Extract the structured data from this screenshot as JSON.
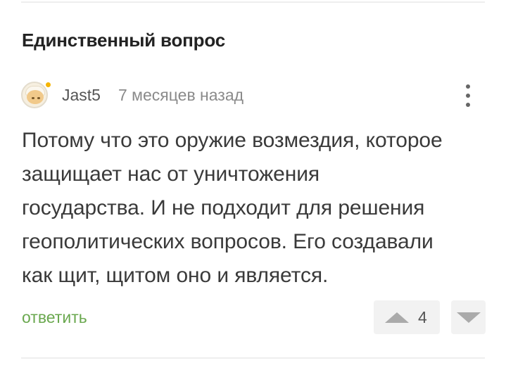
{
  "section": {
    "title": "Единственный вопрос"
  },
  "comment": {
    "author": "Jast5",
    "time": "7 месяцев назад",
    "lines": [
      "Потому что это оружие возмездия, которое",
      "защищает нас от уничтожения",
      "государства. И не подходит для решения",
      "геополитических вопросов. Его создавали",
      "как щит, щитом оно и является."
    ],
    "reply_label": "ответить",
    "rating": "4",
    "menu_icon": "more-vertical-icon",
    "upvote_icon": "triangle-up-icon",
    "downvote_icon": "triangle-down-icon"
  },
  "colors": {
    "reply_link": "#6aa84f",
    "online_indicator": "#f5b400",
    "vote_background": "#f2f2f2"
  }
}
